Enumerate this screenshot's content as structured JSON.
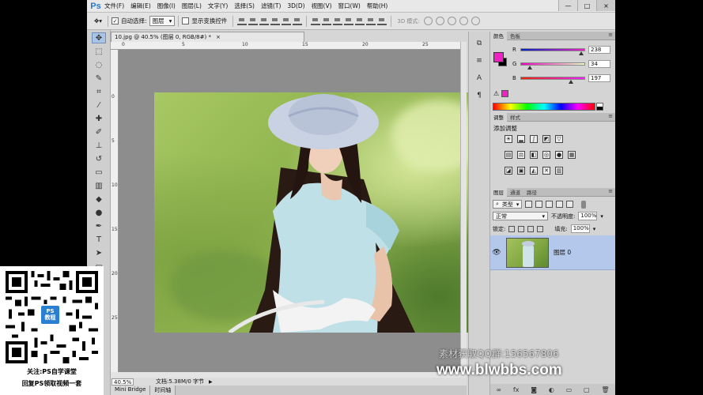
{
  "app": {
    "logo": "Ps",
    "menu": [
      "文件(F)",
      "编辑(E)",
      "图像(I)",
      "图层(L)",
      "文字(Y)",
      "选择(S)",
      "滤镜(T)",
      "3D(D)",
      "视图(V)",
      "窗口(W)",
      "帮助(H)"
    ],
    "window_controls": [
      "—",
      "□",
      "×"
    ]
  },
  "options_bar": {
    "auto_select_label": "自动选择:",
    "auto_select_value": "图层",
    "show_transform_label": "显示变换控件",
    "mode_3d_label": "3D 模式:"
  },
  "document": {
    "tab_title": "10.jpg @ 40.5% (图层 0, RGB/8#) *",
    "ruler_top": [
      "0",
      "5",
      "10",
      "15",
      "20",
      "25"
    ],
    "ruler_left": [
      "0",
      "5",
      "10",
      "15",
      "20",
      "25"
    ],
    "zoom": "40.5%",
    "doc_info": "文档:5.38M/0 字节"
  },
  "bottom_tabs": [
    "Mini Bridge",
    "时间轴"
  ],
  "color_panel": {
    "tabs": [
      "颜色",
      "色板"
    ],
    "channels": [
      {
        "label": "R",
        "value": "238",
        "fraction": 0.93
      },
      {
        "label": "G",
        "value": "34",
        "fraction": 0.13
      },
      {
        "label": "B",
        "value": "197",
        "fraction": 0.77
      }
    ],
    "foreground": "#ee22c5",
    "background": "#000000"
  },
  "adjustments_panel": {
    "tabs": [
      "调整",
      "样式"
    ],
    "title": "添加调整"
  },
  "layers_panel": {
    "tabs": [
      "图层",
      "通道",
      "路径"
    ],
    "filter_kind": "类型",
    "blend_mode": "正常",
    "opacity_label": "不透明度:",
    "opacity_value": "100%",
    "lock_label": "锁定:",
    "fill_label": "填充:",
    "fill_value": "100%",
    "layers": [
      {
        "name": "图层 0",
        "visible": true,
        "selected": true
      }
    ]
  },
  "watermark": {
    "qq_group": "素材获取QQ群:156567806",
    "url": "www.blwbbs.com"
  },
  "qr_overlay": {
    "badge_line1": "PS",
    "badge_line2": "教程",
    "line1": "关注:PS自学课堂",
    "line2": "回复PS领取视频一套"
  }
}
